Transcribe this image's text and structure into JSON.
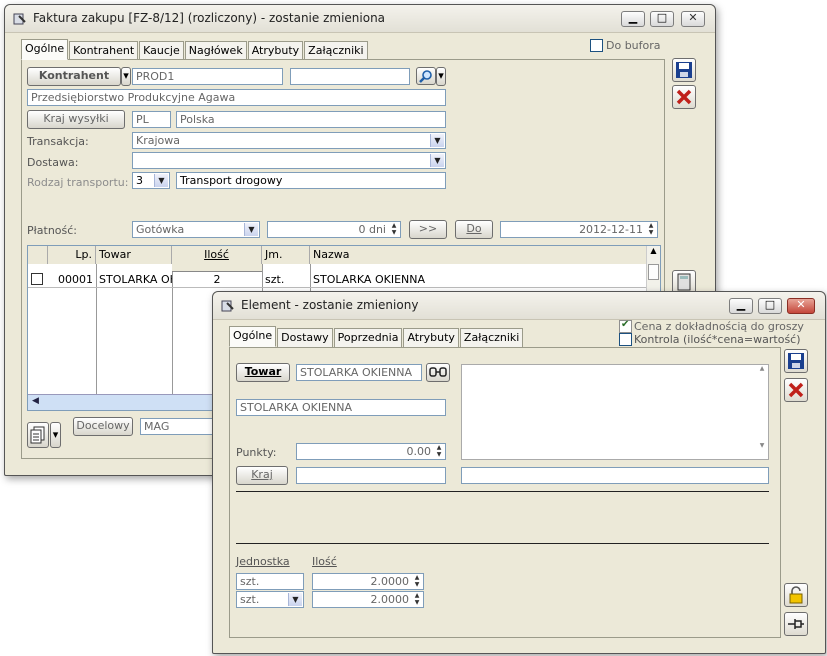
{
  "main_window": {
    "title": "Faktura zakupu [FZ-8/12] (rozliczony) - zostanie zmieniona",
    "tabs": [
      "Ogólne",
      "Kontrahent",
      "Kaucje",
      "Nagłówek",
      "Atrybuty",
      "Załączniki"
    ],
    "do_bufora_label": "Do bufora",
    "kontrahent_button": "Kontrahent",
    "kontrahent_code": "PROD1",
    "kontrahent_search": "",
    "kontrahent_name": "Przedsiębiorstwo Produkcyjne Agawa",
    "kraj_wysylki_button": "Kraj wysyłki",
    "kraj_code": "PL",
    "kraj_name": "Polska",
    "transakcja_label": "Transakcja:",
    "transakcja_value": "Krajowa",
    "dostawa_label": "Dostawa:",
    "dostawa_value": "",
    "rodzaj_transportu_label": "Rodzaj transportu:",
    "rodzaj_transportu_code": "3",
    "rodzaj_transportu_value": "Transport drogowy",
    "platnosc_label": "Płatność:",
    "platnosc_value": "Gotówka",
    "dni_value": "0 dni",
    "arrow_button": ">>",
    "do_button": "Do",
    "date_value": "2012-12-11",
    "grid": {
      "headers": [
        "Lp.",
        "Towar",
        "Ilość",
        "Jm.",
        "Nazwa"
      ],
      "rows": [
        {
          "lp": "00001",
          "towar": "STOLARKA OKIENNA",
          "ilosc": "2",
          "jm": "szt.",
          "nazwa": "STOLARKA OKIENNA"
        }
      ]
    },
    "docelowy_button": "Docelowy",
    "magazyn_value": "MAG"
  },
  "element_window": {
    "title": "Element - zostanie zmieniony",
    "tabs": [
      "Ogólne",
      "Dostawy",
      "Poprzednia",
      "Atrybuty",
      "Załączniki"
    ],
    "cena_checkbox_label": "Cena z dokładnością do groszy",
    "kontrola_checkbox_label": "Kontrola (ilość*cena=wartość)",
    "towar_button": "Towar",
    "towar_code": "STOLARKA OKIENNA",
    "towar_name": "STOLARKA OKIENNA",
    "punkty_label": "Punkty:",
    "punkty_value": "0.00",
    "kraj_button": "Kraj",
    "kraj_value": "",
    "kraj_extra": "",
    "jednostka_label": "Jednostka",
    "ilosc_label": "Ilość",
    "jednostka_1": "szt.",
    "ilosc_1": "2.0000",
    "jednostka_2": "szt.",
    "ilosc_2": "2.0000"
  }
}
